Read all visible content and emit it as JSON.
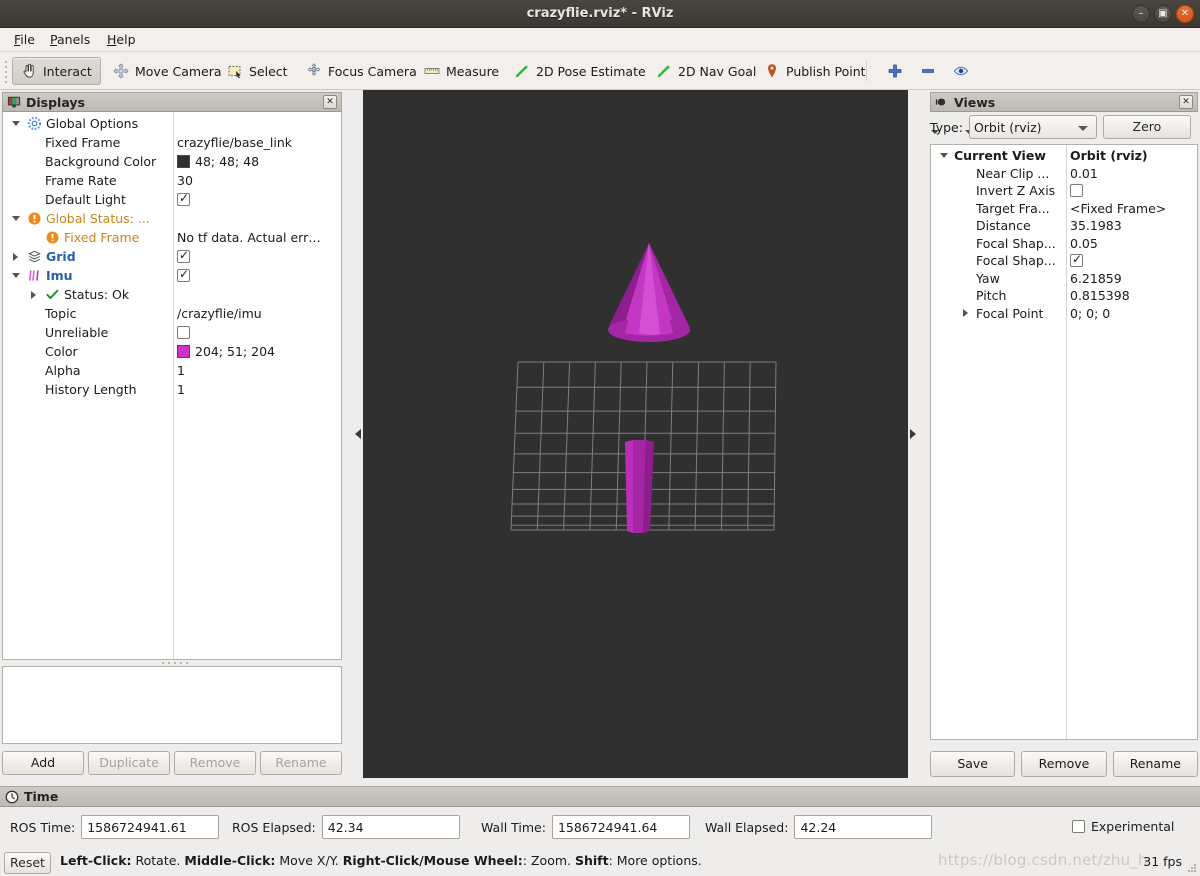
{
  "window": {
    "title": "crazyflie.rviz* - RViz",
    "buttons": {
      "minimize": "minimize-button",
      "maximize": "maximize-button",
      "close": "close-button"
    }
  },
  "menubar": {
    "items": [
      "File",
      "Panels",
      "Help"
    ]
  },
  "toolbar": {
    "items": [
      {
        "label": "Interact",
        "icon": "hand-cursor-icon",
        "active": true
      },
      {
        "label": "Move Camera",
        "icon": "move-camera-icon",
        "active": false
      },
      {
        "label": "Select",
        "icon": "select-rectangle-icon",
        "active": false
      },
      {
        "label": "Focus Camera",
        "icon": "focus-camera-icon",
        "active": false
      },
      {
        "label": "Measure",
        "icon": "ruler-icon",
        "active": false
      },
      {
        "label": "2D Pose Estimate",
        "icon": "green-arrow-icon",
        "active": false
      },
      {
        "label": "2D Nav Goal",
        "icon": "green-arrow-icon",
        "active": false
      },
      {
        "label": "Publish Point",
        "icon": "map-pin-icon",
        "active": false
      }
    ],
    "extra_icons": [
      "plus-icon",
      "minus-icon",
      "eye-icon"
    ]
  },
  "displays": {
    "title": "Displays",
    "title_icon": "display-monitor-icon",
    "rows": [
      {
        "indent": 0,
        "expander": "open",
        "icon": "gear-icon",
        "name": "Global Options",
        "style": "plain",
        "value": "",
        "value_type": "none"
      },
      {
        "indent": 1,
        "expander": "none",
        "icon": "none",
        "name": "Fixed Frame",
        "style": "plain",
        "value": "crazyflie/base_link",
        "value_type": "text"
      },
      {
        "indent": 1,
        "expander": "none",
        "icon": "none",
        "name": "Background Color",
        "style": "plain",
        "value": "48; 48; 48",
        "value_type": "color",
        "swatch": "#303030"
      },
      {
        "indent": 1,
        "expander": "none",
        "icon": "none",
        "name": "Frame Rate",
        "style": "plain",
        "value": "30",
        "value_type": "text"
      },
      {
        "indent": 1,
        "expander": "none",
        "icon": "none",
        "name": "Default Light",
        "style": "plain",
        "value": "",
        "value_type": "checkbox-checked"
      },
      {
        "indent": 0,
        "expander": "open",
        "icon": "warning-icon",
        "name": "Global Status: ...",
        "style": "orange",
        "value": "",
        "value_type": "none"
      },
      {
        "indent": 1,
        "expander": "none",
        "icon": "warning-icon",
        "name": "Fixed Frame",
        "style": "orange",
        "value": "No tf data.  Actual err…",
        "value_type": "text"
      },
      {
        "indent": 0,
        "expander": "closed",
        "icon": "grid-icon",
        "name": "Grid",
        "style": "bluebold",
        "value": "",
        "value_type": "checkbox-checked"
      },
      {
        "indent": 0,
        "expander": "open",
        "icon": "imu-icon",
        "name": "Imu",
        "style": "bluebold",
        "value": "",
        "value_type": "checkbox-checked"
      },
      {
        "indent": 1,
        "expander": "closed",
        "icon": "check-icon",
        "name": "Status: Ok",
        "style": "plain",
        "value": "",
        "value_type": "none"
      },
      {
        "indent": 1,
        "expander": "none",
        "icon": "none",
        "name": "Topic",
        "style": "plain",
        "value": "/crazyflie/imu",
        "value_type": "text"
      },
      {
        "indent": 1,
        "expander": "none",
        "icon": "none",
        "name": "Unreliable",
        "style": "plain",
        "value": "",
        "value_type": "checkbox-unchecked"
      },
      {
        "indent": 1,
        "expander": "none",
        "icon": "none",
        "name": "Color",
        "style": "plain",
        "value": "204; 51; 204",
        "value_type": "color",
        "swatch": "#cc33cc"
      },
      {
        "indent": 1,
        "expander": "none",
        "icon": "none",
        "name": "Alpha",
        "style": "plain",
        "value": "1",
        "value_type": "text"
      },
      {
        "indent": 1,
        "expander": "none",
        "icon": "none",
        "name": "History Length",
        "style": "plain",
        "value": "1",
        "value_type": "text"
      }
    ],
    "buttons": [
      {
        "label": "Add",
        "enabled": true
      },
      {
        "label": "Duplicate",
        "enabled": false
      },
      {
        "label": "Remove",
        "enabled": false
      },
      {
        "label": "Rename",
        "enabled": false
      }
    ]
  },
  "views": {
    "title": "Views",
    "title_icon": "camera-icon",
    "type_label": "Type:",
    "type_value": "Orbit (rviz)",
    "zero_label": "Zero",
    "rows": [
      {
        "indent": 0,
        "expander": "open",
        "name": "Current View",
        "bold": true,
        "value": "Orbit (rviz)",
        "value_type": "text",
        "value_bold": true
      },
      {
        "indent": 1,
        "expander": "none",
        "name": "Near Clip ...",
        "bold": false,
        "value": "0.01",
        "value_type": "text"
      },
      {
        "indent": 1,
        "expander": "none",
        "name": "Invert Z Axis",
        "bold": false,
        "value": "",
        "value_type": "checkbox-unchecked"
      },
      {
        "indent": 1,
        "expander": "none",
        "name": "Target Fra...",
        "bold": false,
        "value": "<Fixed Frame>",
        "value_type": "text"
      },
      {
        "indent": 1,
        "expander": "none",
        "name": "Distance",
        "bold": false,
        "value": "35.1983",
        "value_type": "text"
      },
      {
        "indent": 1,
        "expander": "none",
        "name": "Focal Shap...",
        "bold": false,
        "value": "0.05",
        "value_type": "text"
      },
      {
        "indent": 1,
        "expander": "none",
        "name": "Focal Shap...",
        "bold": false,
        "value": "",
        "value_type": "checkbox-checked"
      },
      {
        "indent": 1,
        "expander": "none",
        "name": "Yaw",
        "bold": false,
        "value": "6.21859",
        "value_type": "text"
      },
      {
        "indent": 1,
        "expander": "none",
        "name": "Pitch",
        "bold": false,
        "value": "0.815398",
        "value_type": "text"
      },
      {
        "indent": 1,
        "expander": "closed",
        "name": "Focal Point",
        "bold": false,
        "value": "0; 0; 0",
        "value_type": "text"
      }
    ],
    "buttons": [
      {
        "label": "Save"
      },
      {
        "label": "Remove"
      },
      {
        "label": "Rename"
      }
    ]
  },
  "time": {
    "title": "Time",
    "title_icon": "clock-icon",
    "fields": [
      {
        "label": "ROS Time:",
        "value": "1586724941.61"
      },
      {
        "label": "ROS Elapsed:",
        "value": "42.34"
      },
      {
        "label": "Wall Time:",
        "value": "1586724941.64"
      },
      {
        "label": "Wall Elapsed:",
        "value": "42.24"
      }
    ],
    "experimental_label": "Experimental",
    "experimental_checked": false
  },
  "statusbar": {
    "reset_label": "Reset",
    "hint_parts": [
      {
        "text": "Left-Click:",
        "bold": true
      },
      {
        "text": " Rotate. ",
        "bold": false
      },
      {
        "text": "Middle-Click:",
        "bold": true
      },
      {
        "text": " Move X/Y. ",
        "bold": false
      },
      {
        "text": "Right-Click/Mouse Wheel:",
        "bold": true
      },
      {
        "text": ": Zoom. ",
        "bold": false
      },
      {
        "text": "Shift",
        "bold": true
      },
      {
        "text": ": More options.",
        "bold": false
      }
    ],
    "fps": "31 fps",
    "watermark": "https://blog.csdn.net/zhu_h"
  },
  "view3d": {
    "background_color": "#303030",
    "grid_color": "#9c9c9c",
    "grid_cells": 10,
    "arrow_color": "#cc33cc",
    "arrow_name": "imu-orientation-arrow"
  },
  "colors": {
    "accent_blue": "#2a5db0",
    "warning_orange": "#e08b18",
    "magenta": "#cc33cc",
    "panel_bg": "#efedeb",
    "viewport_bg": "#303030"
  }
}
